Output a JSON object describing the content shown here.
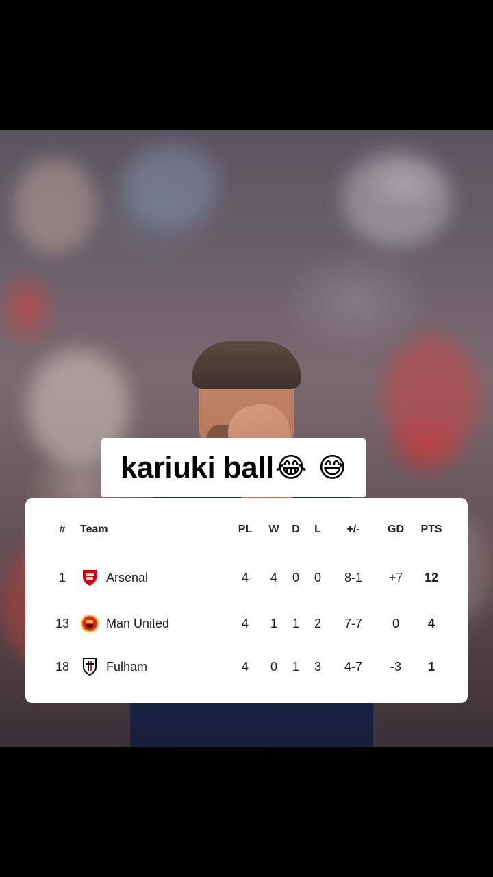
{
  "caption": {
    "text": "kariuki ball",
    "emoji_1": "😂",
    "emoji_2": "😅"
  },
  "table": {
    "headers": {
      "pos": "#",
      "team": "Team",
      "pl": "PL",
      "w": "W",
      "d": "D",
      "l": "L",
      "score": "+/-",
      "gd": "GD",
      "pts": "PTS"
    },
    "rows": [
      {
        "pos": "1",
        "team": "Arsenal",
        "pl": "4",
        "w": "4",
        "d": "0",
        "l": "0",
        "score": "8-1",
        "gd": "+7",
        "pts": "12",
        "crest_icon": "arsenal-crest-icon",
        "crest_color": "#db0007"
      },
      {
        "pos": "13",
        "team": "Man United",
        "pl": "4",
        "w": "1",
        "d": "1",
        "l": "2",
        "score": "7-7",
        "gd": "0",
        "pts": "4",
        "crest_icon": "man-united-crest-icon",
        "crest_color": "#da291c"
      },
      {
        "pos": "18",
        "team": "Fulham",
        "pl": "4",
        "w": "0",
        "d": "1",
        "l": "3",
        "score": "4-7",
        "gd": "-3",
        "pts": "1",
        "crest_icon": "fulham-crest-icon",
        "crest_color": "#000000"
      }
    ]
  }
}
